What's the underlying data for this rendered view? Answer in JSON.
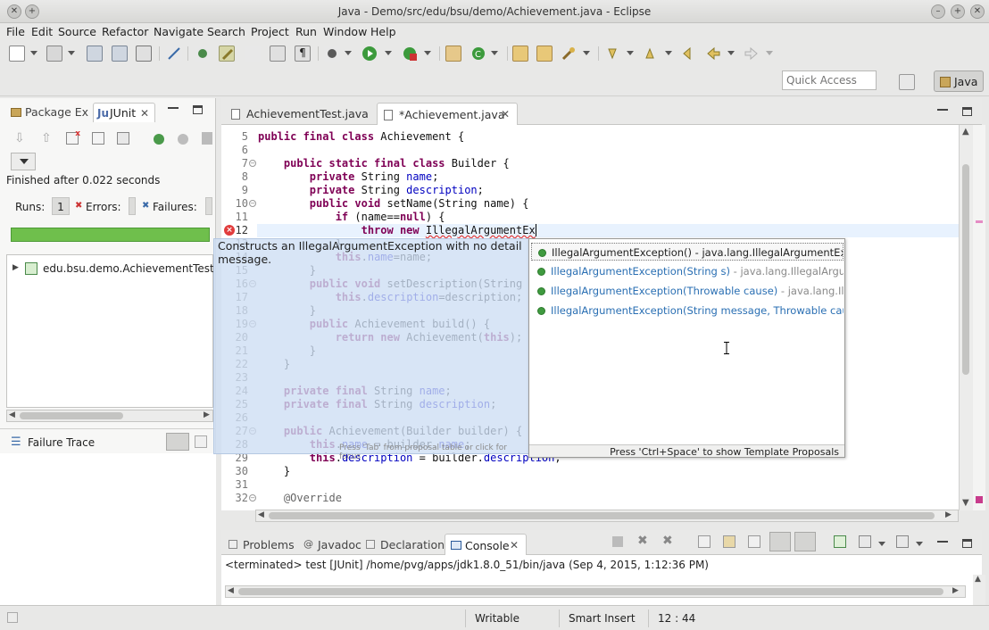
{
  "window": {
    "title": "Java - Demo/src/edu/bsu/demo/Achievement.java - Eclipse"
  },
  "menu": [
    "File",
    "Edit",
    "Source",
    "Refactor",
    "Navigate",
    "Search",
    "Project",
    "Run",
    "Window",
    "Help"
  ],
  "quick_access": {
    "placeholder": "Quick Access"
  },
  "perspective": {
    "label": "Java"
  },
  "left_panel": {
    "tabs": {
      "package_explorer": "Package Ex",
      "junit": "JUnit"
    },
    "status": "Finished after 0.022 seconds",
    "runs_label": "Runs:",
    "runs_value": "1",
    "errors_label": "Errors:",
    "failures_label": "Failures:",
    "tree_item": "edu.bsu.demo.AchievementTest [",
    "failure_trace": "Failure Trace"
  },
  "editor": {
    "tabs": {
      "test": "AchievementTest.java",
      "main": "*Achievement.java"
    },
    "lines": [
      {
        "n": "5",
        "html": "<span class='kw'>public final class</span> Achievement {"
      },
      {
        "n": "6",
        "html": ""
      },
      {
        "n": "7",
        "html": "    <span class='kw'>public static final class</span> Builder {"
      },
      {
        "n": "8",
        "html": "        <span class='kw'>private</span> String <span class='fld'>name</span>;"
      },
      {
        "n": "9",
        "html": "        <span class='kw'>private</span> String <span class='fld'>description</span>;"
      },
      {
        "n": "10",
        "html": "        <span class='kw'>public void</span> setName(String name) {"
      },
      {
        "n": "11",
        "html": "            <span class='kw'>if</span> (name==<span class='kw'>null</span>) {"
      },
      {
        "n": "12",
        "html": "                <span class='kw'>throw new</span> IllegalArgumentEx"
      },
      {
        "n": "13",
        "html": "            }"
      },
      {
        "n": "14",
        "html": "            <span class='kw'>this</span>.<span class='fld'>name</span>=name;"
      },
      {
        "n": "15",
        "html": "        }"
      },
      {
        "n": "16",
        "html": "        <span class='kw'>public void</span> setDescription(String d"
      },
      {
        "n": "17",
        "html": "            <span class='kw'>this</span>.<span class='fld'>description</span>=description;"
      },
      {
        "n": "18",
        "html": "        }"
      },
      {
        "n": "19",
        "html": "        <span class='kw'>public</span> Achievement build() {"
      },
      {
        "n": "20",
        "html": "            <span class='kw'>return new</span> Achievement(<span class='kw'>this</span>);"
      },
      {
        "n": "21",
        "html": "        }"
      },
      {
        "n": "22",
        "html": "    }"
      },
      {
        "n": "23",
        "html": ""
      },
      {
        "n": "24",
        "html": "    <span class='kw'>private final</span> String <span class='fld'>name</span>;"
      },
      {
        "n": "25",
        "html": "    <span class='kw'>private final</span> String <span class='fld'>description</span>;"
      },
      {
        "n": "26",
        "html": ""
      },
      {
        "n": "27",
        "html": "    <span class='kw'>public</span> Achievement(Builder builder) {"
      },
      {
        "n": "28",
        "html": "        <span class='kw'>this</span>.<span class='fld'>name</span> = builder.<span class='fld'>name</span>;"
      },
      {
        "n": "29",
        "html": "        <span class='kw'>this</span>.<span class='fld'>description</span> = builder.<span class='fld'>description</span>;"
      },
      {
        "n": "30",
        "html": "    }"
      },
      {
        "n": "31",
        "html": ""
      },
      {
        "n": "32",
        "html": "    <span class='ann'>@Override</span>"
      }
    ]
  },
  "javadoc": {
    "text": "Constructs an IllegalArgumentException with no detail message.",
    "hint": "Press 'Tab' from proposal table or click for focus"
  },
  "proposals": {
    "items": [
      {
        "m": "IllegalArgumentException()",
        "q": " - java.lang.IllegalArgumentExc"
      },
      {
        "m": "IllegalArgumentException(String s)",
        "q": " - java.lang.IllegalArgum"
      },
      {
        "m": "IllegalArgumentException(Throwable cause)",
        "q": " - java.lang.Ille"
      },
      {
        "m": "IllegalArgumentException(String message, Throwable cau",
        "q": ""
      }
    ],
    "footer": "Press 'Ctrl+Space' to show Template Proposals"
  },
  "bottom_panel": {
    "tabs": {
      "problems": "Problems",
      "javadoc": "Javadoc",
      "declaration": "Declaration",
      "console": "Console"
    },
    "console_text": "<terminated> test [JUnit] /home/pvg/apps/jdk1.8.0_51/bin/java (Sep 4, 2015, 1:12:36 PM)"
  },
  "status_bar": {
    "writable": "Writable",
    "insert_mode": "Smart Insert",
    "position": "12 : 44"
  },
  "colors": {
    "keyword": "#7f0055",
    "field": "#0000c0",
    "progress": "#6fbf4c",
    "error": "#e13c3c"
  }
}
